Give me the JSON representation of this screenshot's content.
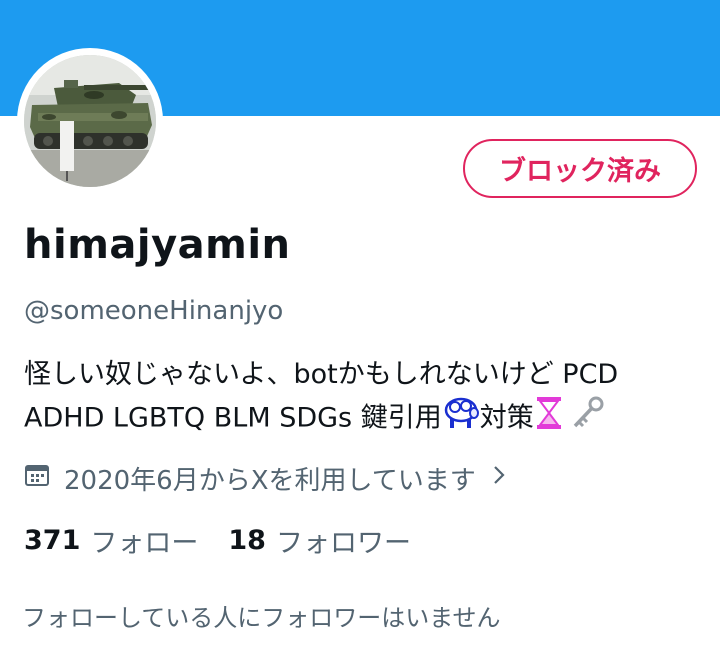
{
  "profile": {
    "display_name": "himajyamin",
    "handle": "@someoneHinanjyo",
    "blocked_label": "ブロック済み",
    "bio": {
      "line1": "怪しい奴じゃないよ、botかもしれないけど PCD",
      "line2_text": "ADHD LGBTQ BLM SDGs 鍵引用",
      "line2_mid": "対策",
      "emoji_icons": [
        "sheep-emoji-icon",
        "hourglass-emoji-icon",
        "key-emoji-icon"
      ]
    },
    "joined": "2020年6月からXを利用しています",
    "stats": {
      "following_count": "371",
      "following_label": "フォロー",
      "followers_count": "18",
      "followers_label": "フォロワー"
    },
    "mutuals_text": "フォローしている人にフォロワーはいません"
  },
  "colors": {
    "banner": "#1d9bf0",
    "blocked": "#e0245e",
    "secondary_text": "#536471",
    "primary_text": "#0f1419"
  }
}
